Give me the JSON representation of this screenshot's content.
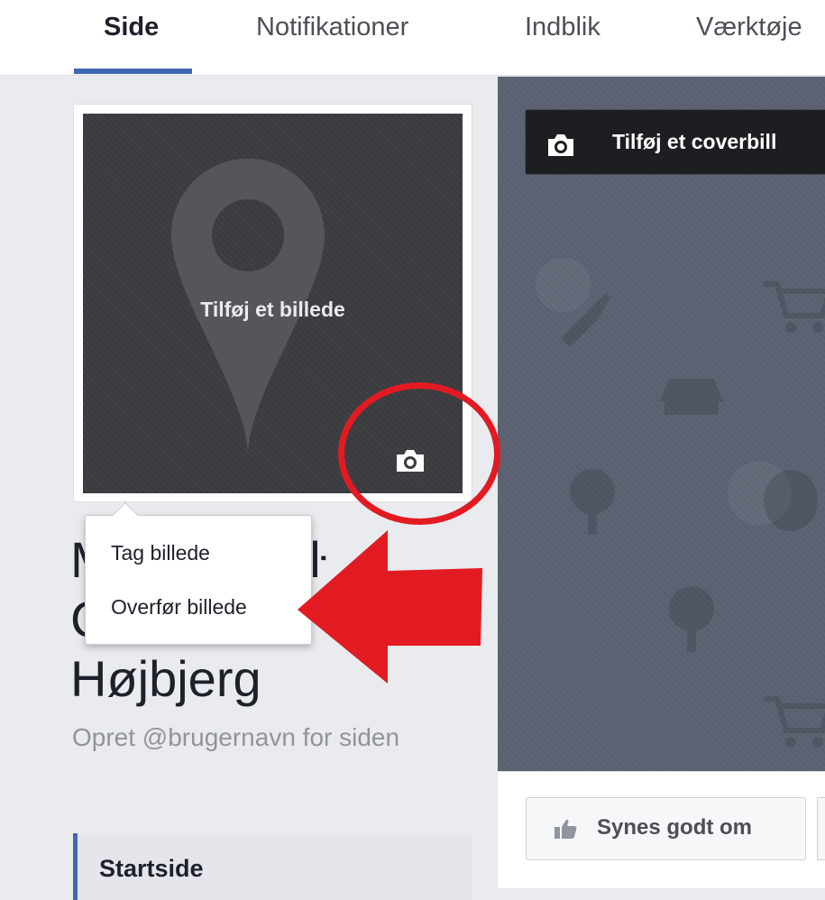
{
  "tabs": [
    {
      "label": "Side",
      "active": true
    },
    {
      "label": "Notifikationer",
      "active": false
    },
    {
      "label": "Indblik",
      "active": false
    },
    {
      "label": "Værktøje",
      "active": false
    }
  ],
  "profile": {
    "add_photo_label": "Tilføj et billede",
    "name_lines": [
      "M",
      "C",
      "Højbjerg"
    ],
    "name_line1_tail": "friŀ",
    "username_prompt": "Opret @brugernavn for siden"
  },
  "photo_menu": {
    "items": [
      "Tag billede",
      "Overfør billede"
    ]
  },
  "cover": {
    "add_cover_label": "Tilføj et coverbill"
  },
  "actions": {
    "like_label": "Synes godt om"
  },
  "nav": {
    "startside_label": "Startside"
  },
  "colors": {
    "accent": "#4267b2",
    "annotation_red": "#e21b23"
  },
  "icons": [
    "camera-icon",
    "map-pin-icon",
    "thumbs-up-icon"
  ]
}
